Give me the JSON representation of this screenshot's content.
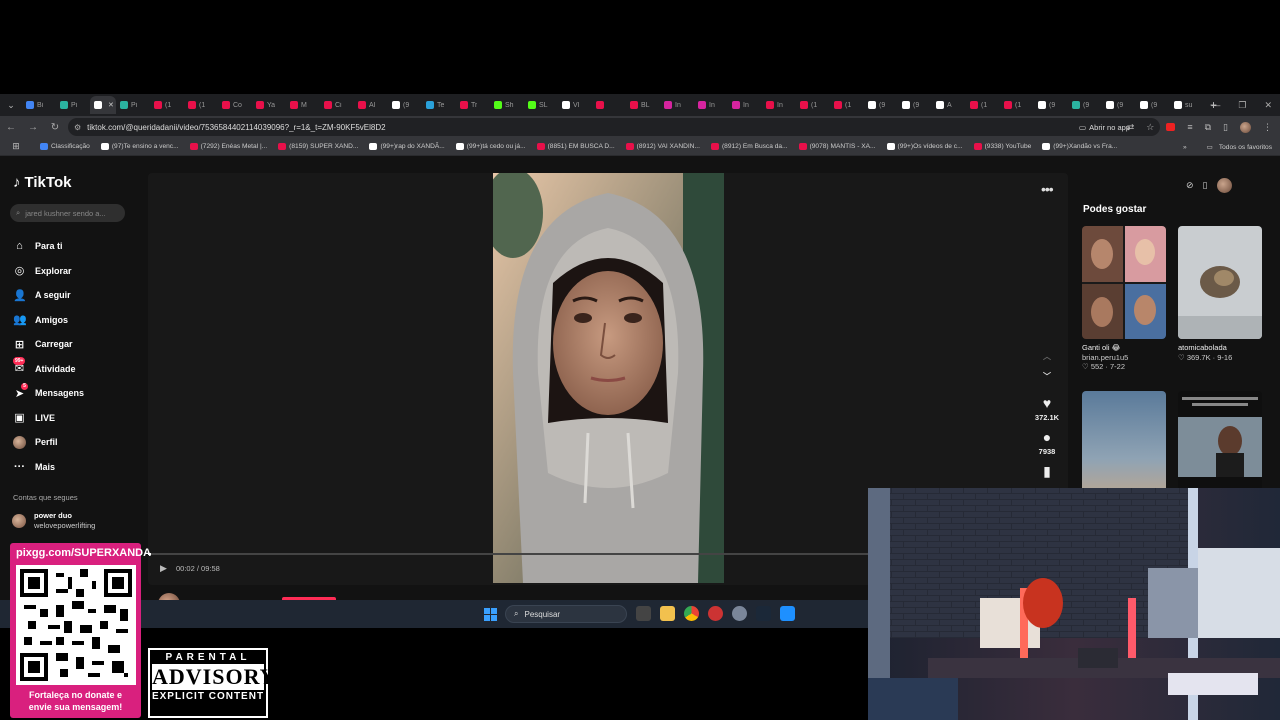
{
  "browser": {
    "tabs": [
      {
        "label": "Bi",
        "color": "#4285f4"
      },
      {
        "label": "Pi",
        "color": "#2bb3a0"
      },
      {
        "label": "",
        "color": "#ffffff",
        "active": true
      },
      {
        "label": "Pi",
        "color": "#2bb3a0"
      },
      {
        "label": "(1",
        "color": "#e8104a"
      },
      {
        "label": "(1",
        "color": "#e8104a"
      },
      {
        "label": "Co",
        "color": "#e8104a"
      },
      {
        "label": "Ya",
        "color": "#e8104a"
      },
      {
        "label": "M",
        "color": "#e8104a"
      },
      {
        "label": "Ci",
        "color": "#e8104a"
      },
      {
        "label": "Al",
        "color": "#e8104a"
      },
      {
        "label": "(9",
        "color": "#ffffff"
      },
      {
        "label": "Te",
        "color": "#2aa1da"
      },
      {
        "label": "Tr",
        "color": "#e8104a"
      },
      {
        "label": "Sh",
        "color": "#53fc18"
      },
      {
        "label": "SL",
        "color": "#53fc18"
      },
      {
        "label": "VI",
        "color": "#ffffff"
      },
      {
        "label": "",
        "color": "#e8104a"
      },
      {
        "label": "BL",
        "color": "#e8104a"
      },
      {
        "label": "In",
        "color": "#d6249f"
      },
      {
        "label": "In",
        "color": "#d6249f"
      },
      {
        "label": "In",
        "color": "#d6249f"
      },
      {
        "label": "In",
        "color": "#e8104a"
      },
      {
        "label": "(1",
        "color": "#e8104a"
      },
      {
        "label": "(1",
        "color": "#e8104a"
      },
      {
        "label": "(9",
        "color": "#ffffff"
      },
      {
        "label": "(9",
        "color": "#ffffff"
      },
      {
        "label": "A",
        "color": "#ffffff"
      },
      {
        "label": "(1",
        "color": "#e8104a"
      },
      {
        "label": "(1",
        "color": "#e8104a"
      },
      {
        "label": "(9",
        "color": "#ffffff"
      },
      {
        "label": "(9",
        "color": "#2bb3a0"
      },
      {
        "label": "(9",
        "color": "#ffffff"
      },
      {
        "label": "(9",
        "color": "#ffffff"
      },
      {
        "label": "su",
        "color": "#ffffff"
      }
    ],
    "url": "tiktok.com/@queridadanii/video/7536584402114039096?_r=1&_t=ZM-90KF5vEl8D2",
    "open_app_label": "Abrir no app",
    "bookmarks": [
      {
        "label": "Classificação",
        "color": "#4285f4"
      },
      {
        "label": "(97)Te ensino a venc...",
        "color": "#ffffff"
      },
      {
        "label": "(7292) Enéas Metal |...",
        "color": "#e8104a"
      },
      {
        "label": "(8159) SUPER XAND...",
        "color": "#e8104a"
      },
      {
        "label": "(99+)rap do XANDÃ...",
        "color": "#ffffff"
      },
      {
        "label": "(99+)tá cedo ou já...",
        "color": "#ffffff"
      },
      {
        "label": "(8851) EM BUSCA D...",
        "color": "#e8104a"
      },
      {
        "label": "(8912) VAI XANDIN...",
        "color": "#e8104a"
      },
      {
        "label": "(8912) Em Busca da...",
        "color": "#e8104a"
      },
      {
        "label": "(9078) MANTIS - XA...",
        "color": "#e8104a"
      },
      {
        "label": "(99+)Os vídeos de c...",
        "color": "#ffffff"
      },
      {
        "label": "(9338) YouTube",
        "color": "#e8104a"
      },
      {
        "label": "(99+)Xandão vs Fra...",
        "color": "#ffffff"
      }
    ],
    "all_favorites": "Todos os favoritos"
  },
  "tiktok": {
    "logo": "TikTok",
    "search_placeholder": "jared kushner sendo a...",
    "nav": [
      {
        "label": "Para ti",
        "icon": "home-icon"
      },
      {
        "label": "Explorar",
        "icon": "compass-icon"
      },
      {
        "label": "A seguir",
        "icon": "following-icon"
      },
      {
        "label": "Amigos",
        "icon": "friends-icon"
      },
      {
        "label": "Carregar",
        "icon": "upload-icon"
      },
      {
        "label": "Atividade",
        "icon": "activity-icon",
        "badge": "99+"
      },
      {
        "label": "Mensagens",
        "icon": "messages-icon",
        "badge": "5"
      },
      {
        "label": "LIVE",
        "icon": "live-icon"
      },
      {
        "label": "Perfil",
        "icon": "profile-avatar"
      },
      {
        "label": "Mais",
        "icon": "more-icon"
      }
    ],
    "following_title": "Contas que segues",
    "following": [
      {
        "name": "power duo",
        "handle": "welovepowerlifting"
      }
    ],
    "video": {
      "time": "00:02 / 09:58",
      "progress": 0.0035,
      "author": "queridadanii",
      "likes": "372.1K",
      "comments": "7938"
    },
    "suggestions_title": "Podes gostar",
    "suggestions": [
      {
        "caption": "Ganti oli 😂",
        "author": "brian.peru1u5",
        "likes": "552",
        "date": "7-22"
      },
      {
        "caption": "atomicabolada",
        "author": "",
        "likes": "369.7K",
        "date": "9-16"
      },
      {
        "caption": "",
        "author": "",
        "likes": "",
        "date": ""
      },
      {
        "caption": "",
        "author": "",
        "likes": "",
        "date": ""
      }
    ]
  },
  "taskbar": {
    "search_placeholder": "Pesquisar"
  },
  "overlay": {
    "qr_url": "pixgg.com/SUPERXANDA",
    "qr_caption_1": "Fortaleça no donate e",
    "qr_caption_2": "envie sua mensagem!",
    "advisory_top": "PARENTAL",
    "advisory_mid": "ADVISORY",
    "advisory_bot": "EXPLICIT CONTENT"
  },
  "colors": {
    "accent": "#fe2c55",
    "qr_panel": "#d9207e",
    "page_bg": "#121212"
  }
}
